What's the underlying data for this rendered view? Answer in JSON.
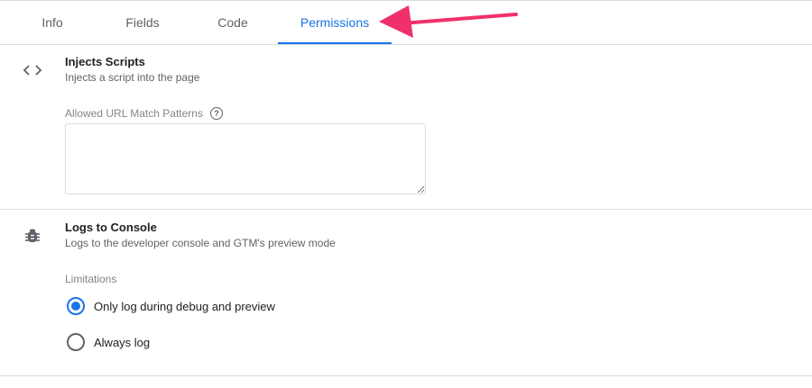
{
  "tabs": [
    {
      "label": "Info",
      "active": false
    },
    {
      "label": "Fields",
      "active": false
    },
    {
      "label": "Code",
      "active": false
    },
    {
      "label": "Permissions",
      "active": true
    }
  ],
  "injects_scripts": {
    "icon": "code-brackets-icon",
    "title": "Injects Scripts",
    "description": "Injects a script into the page",
    "field_label": "Allowed URL Match Patterns",
    "help_icon": "help-circle-icon",
    "field_value": ""
  },
  "logs_to_console": {
    "icon": "bug-icon",
    "title": "Logs to Console",
    "description": "Logs to the developer console and GTM's preview mode",
    "limitations_label": "Limitations",
    "options": [
      {
        "label": "Only log during debug and preview",
        "selected": true
      },
      {
        "label": "Always log",
        "selected": false
      }
    ]
  },
  "annotation": {
    "arrow_color": "#f0306a",
    "points_to": "Permissions"
  },
  "colors": {
    "accent": "#1a73e8",
    "divider": "#dadce0",
    "arrow": "#f0306a"
  }
}
